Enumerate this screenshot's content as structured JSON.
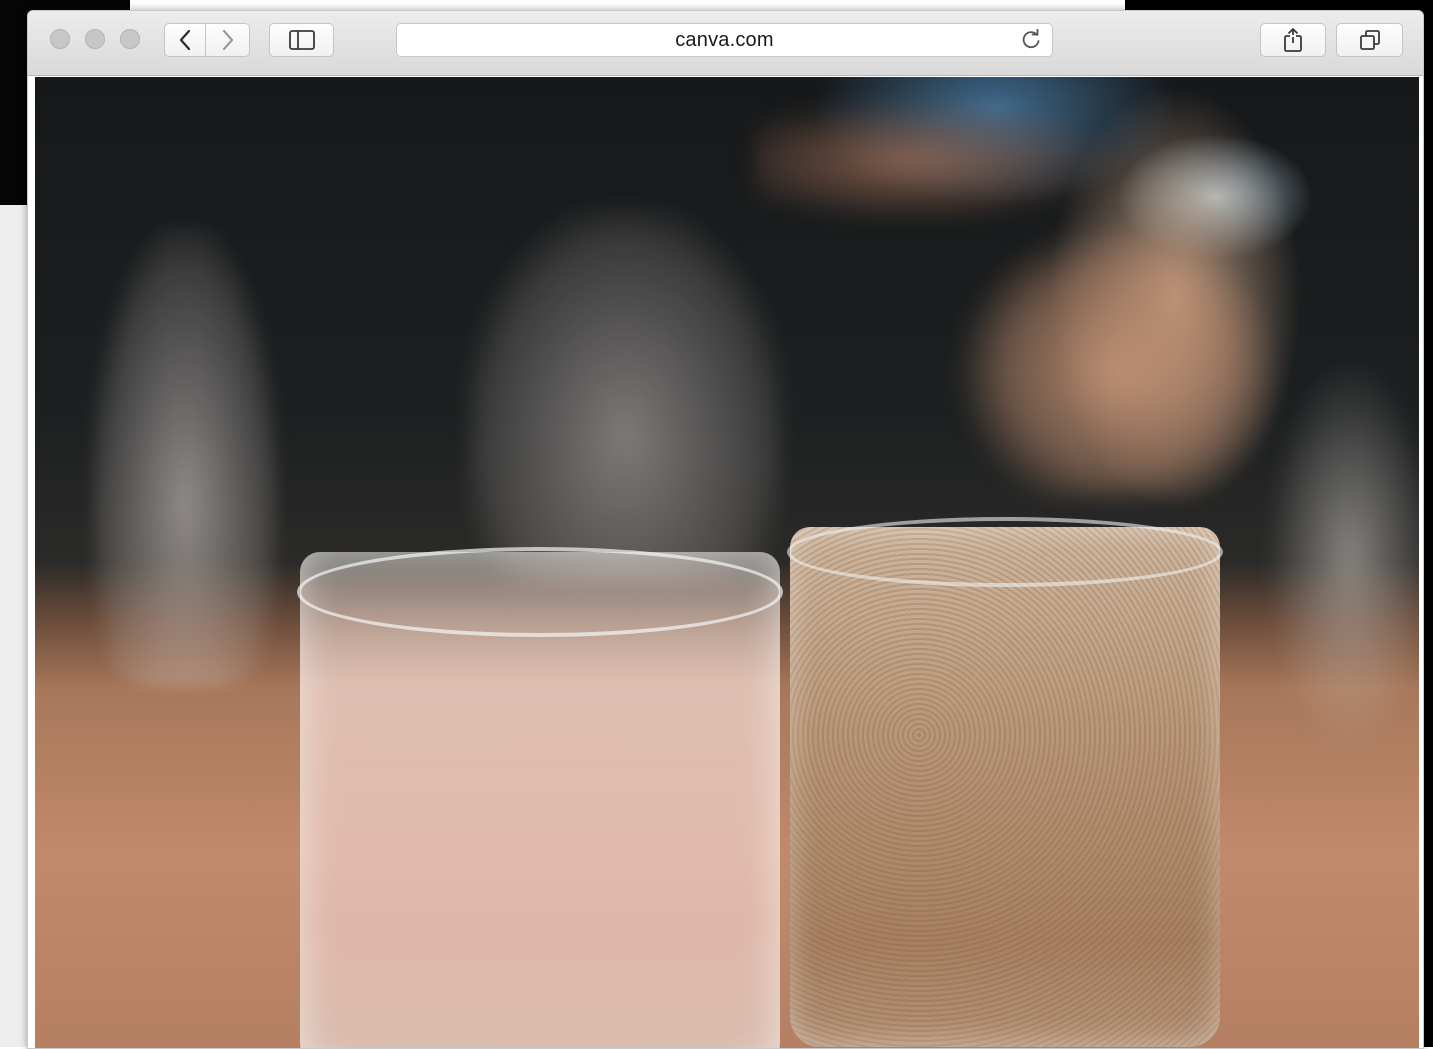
{
  "browser": {
    "url": "canva.com",
    "buttons": {
      "back": "back",
      "forward": "forward",
      "sidebar": "sidebar",
      "reload": "reload",
      "share": "share",
      "tabs": "tabs"
    }
  },
  "colors": {
    "toolbar_top": "#ececec",
    "toolbar_bottom": "#d9d9d9",
    "traffic_light_inactive": "#c7c7c7"
  },
  "icons": [
    "chevron-left-icon",
    "chevron-right-icon",
    "sidebar-icon",
    "reload-icon",
    "share-icon",
    "tabs-icon"
  ]
}
